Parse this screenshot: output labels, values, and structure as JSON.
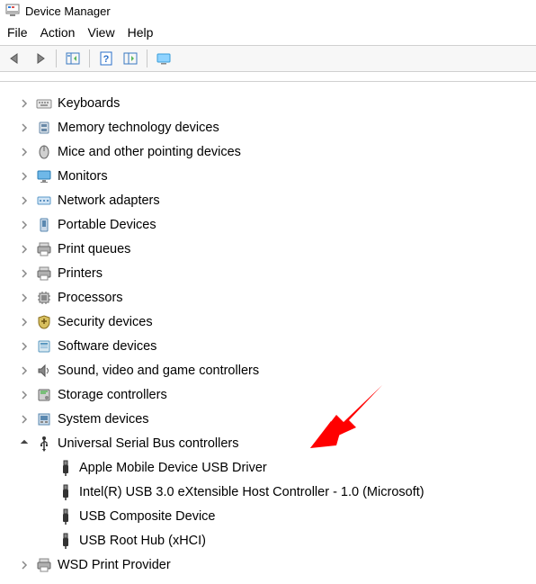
{
  "window": {
    "title": "Device Manager"
  },
  "menu": {
    "file": "File",
    "action": "Action",
    "view": "View",
    "help": "Help"
  },
  "tree": {
    "items": [
      {
        "label": "Keyboards",
        "icon": "keyboard",
        "expanded": false,
        "children": []
      },
      {
        "label": "Memory technology devices",
        "icon": "memory",
        "expanded": false,
        "children": []
      },
      {
        "label": "Mice and other pointing devices",
        "icon": "mouse",
        "expanded": false,
        "children": []
      },
      {
        "label": "Monitors",
        "icon": "monitor",
        "expanded": false,
        "children": []
      },
      {
        "label": "Network adapters",
        "icon": "network",
        "expanded": false,
        "children": []
      },
      {
        "label": "Portable Devices",
        "icon": "portable",
        "expanded": false,
        "children": []
      },
      {
        "label": "Print queues",
        "icon": "printer",
        "expanded": false,
        "children": []
      },
      {
        "label": "Printers",
        "icon": "printer",
        "expanded": false,
        "children": []
      },
      {
        "label": "Processors",
        "icon": "cpu",
        "expanded": false,
        "children": []
      },
      {
        "label": "Security devices",
        "icon": "security",
        "expanded": false,
        "children": []
      },
      {
        "label": "Software devices",
        "icon": "software",
        "expanded": false,
        "children": []
      },
      {
        "label": "Sound, video and game controllers",
        "icon": "sound",
        "expanded": false,
        "children": []
      },
      {
        "label": "Storage controllers",
        "icon": "storage",
        "expanded": false,
        "children": []
      },
      {
        "label": "System devices",
        "icon": "system",
        "expanded": false,
        "children": []
      },
      {
        "label": "Universal Serial Bus controllers",
        "icon": "usb",
        "expanded": true,
        "children": [
          {
            "label": "Apple Mobile Device USB Driver",
            "icon": "usb-plug"
          },
          {
            "label": "Intel(R) USB 3.0 eXtensible Host Controller - 1.0 (Microsoft)",
            "icon": "usb-plug"
          },
          {
            "label": "USB Composite Device",
            "icon": "usb-plug"
          },
          {
            "label": "USB Root Hub (xHCI)",
            "icon": "usb-plug"
          }
        ]
      },
      {
        "label": "WSD Print Provider",
        "icon": "printer",
        "expanded": false,
        "children": []
      }
    ]
  },
  "annotation": {
    "arrow_points_to": "Apple Mobile Device USB Driver"
  }
}
